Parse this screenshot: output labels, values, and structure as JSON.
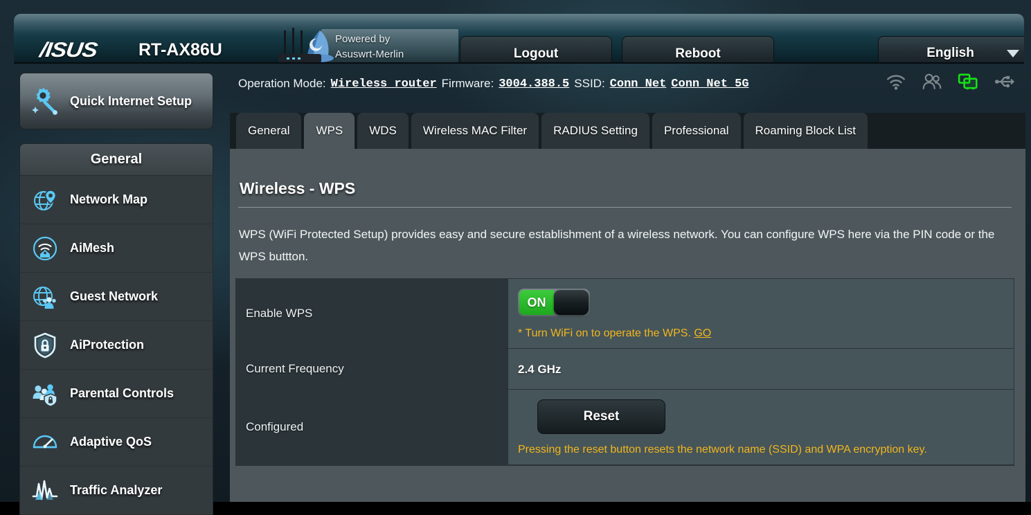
{
  "header": {
    "brand": "/ISUS",
    "model": "RT-AX86U",
    "powered_by_line1": "Powered by",
    "powered_by_line2": "Asuswrt-Merlin",
    "logout_label": "Logout",
    "reboot_label": "Reboot",
    "language": "English"
  },
  "status": {
    "operation_mode_label": "Operation Mode:",
    "operation_mode_value": "Wireless router",
    "firmware_label": "Firmware:",
    "firmware_value": "3004.388.5",
    "ssid_label": "SSID:",
    "ssid_24": "Conn Net",
    "ssid_5g": "Conn Net 5G",
    "icons": [
      {
        "name": "wifi-icon",
        "active": false
      },
      {
        "name": "clients-icon",
        "active": false
      },
      {
        "name": "lan-monitor-icon",
        "active": true
      },
      {
        "name": "usb-icon",
        "active": false
      }
    ]
  },
  "sidebar": {
    "quick_setup_label": "Quick Internet Setup",
    "section_title": "General",
    "items": [
      {
        "label": "Network Map",
        "icon": "network-map-icon"
      },
      {
        "label": "AiMesh",
        "icon": "aimesh-icon"
      },
      {
        "label": "Guest Network",
        "icon": "guest-network-icon"
      },
      {
        "label": "AiProtection",
        "icon": "aiprotection-icon"
      },
      {
        "label": "Parental Controls",
        "icon": "parental-controls-icon"
      },
      {
        "label": "Adaptive QoS",
        "icon": "adaptive-qos-icon"
      },
      {
        "label": "Traffic Analyzer",
        "icon": "traffic-analyzer-icon"
      }
    ]
  },
  "tabs": [
    {
      "label": "General",
      "active": false
    },
    {
      "label": "WPS",
      "active": true
    },
    {
      "label": "WDS",
      "active": false
    },
    {
      "label": "Wireless MAC Filter",
      "active": false
    },
    {
      "label": "RADIUS Setting",
      "active": false
    },
    {
      "label": "Professional",
      "active": false
    },
    {
      "label": "Roaming Block List",
      "active": false
    }
  ],
  "main": {
    "title": "Wireless - WPS",
    "description": "WPS (WiFi Protected Setup) provides easy and secure establishment of a wireless network. You can configure WPS here via the PIN code or the WPS buttton.",
    "rows": {
      "enable_wps": {
        "label": "Enable WPS",
        "toggle_state": "ON",
        "hint_text": "* Turn WiFi on to operate the WPS. ",
        "hint_link": "GO"
      },
      "current_frequency": {
        "label": "Current Frequency",
        "value": "2.4 GHz"
      },
      "configured": {
        "label": "Configured",
        "button_label": "Reset",
        "note": "Pressing the reset button resets the network name (SSID) and WPA encryption key."
      }
    }
  },
  "colors": {
    "accent_blue": "#5bc8f5",
    "toggle_green": "#2eb82e",
    "warning_amber": "#f2b61d",
    "panel_slate": "#4e585c",
    "label_dark": "#2b3438"
  }
}
